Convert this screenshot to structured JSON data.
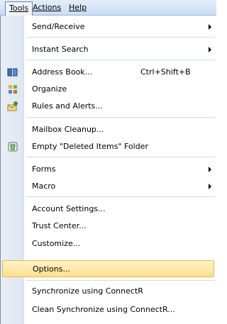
{
  "menubar": {
    "tools": "Tools",
    "actions": "Actions",
    "help": "Help"
  },
  "menu": {
    "items": [
      {
        "label": "Send/Receive"
      },
      {
        "label": "Instant Search"
      },
      {
        "label": "Address Book...",
        "shortcut": "Ctrl+Shift+B"
      },
      {
        "label": "Organize"
      },
      {
        "label": "Rules and Alerts..."
      },
      {
        "label": "Mailbox Cleanup..."
      },
      {
        "label": "Empty \"Deleted Items\" Folder"
      },
      {
        "label": "Forms"
      },
      {
        "label": "Macro"
      },
      {
        "label": "Account Settings..."
      },
      {
        "label": "Trust Center..."
      },
      {
        "label": "Customize..."
      },
      {
        "label": "Options..."
      },
      {
        "label": "Synchronize using ConnectR"
      },
      {
        "label": "Clean Synchronize using ConnectR..."
      }
    ]
  },
  "icons": {
    "address_book": "address-book-icon",
    "organize": "organize-icon",
    "rules": "rules-and-alerts-icon",
    "empty_deleted": "recycle-bin-icon"
  },
  "colors": {
    "highlight_top": "#fff3c9",
    "highlight_bottom": "#ffe08c",
    "menubar_top": "#e3edfb"
  }
}
